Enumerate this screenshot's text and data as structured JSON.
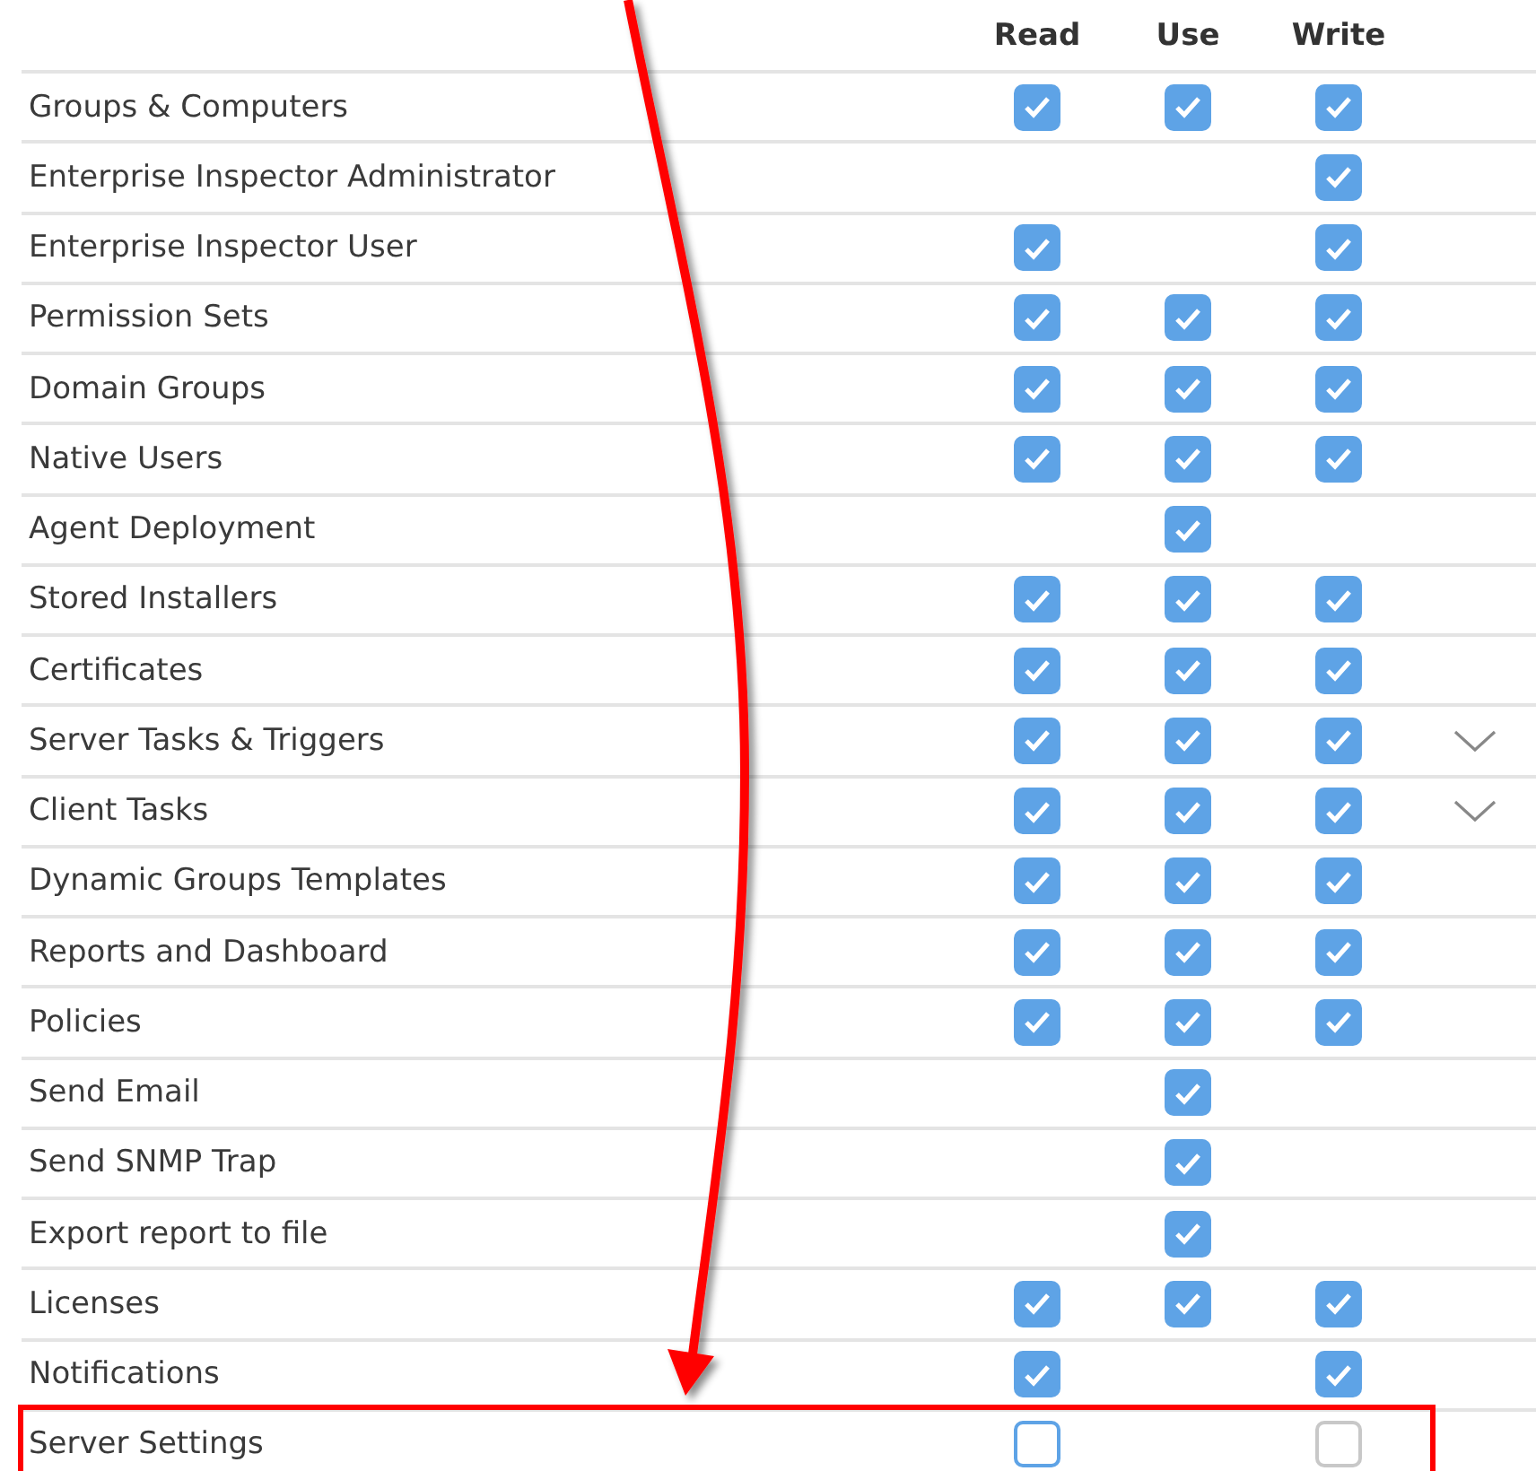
{
  "columns": [
    "Read",
    "Use",
    "Write"
  ],
  "rows": [
    {
      "label": "Groups & Computers",
      "read": {
        "checked": true,
        "disabled": false
      },
      "use": {
        "checked": true,
        "disabled": false
      },
      "write": {
        "checked": true,
        "disabled": false
      },
      "expandable": false,
      "highlighted": false
    },
    {
      "label": "Enterprise Inspector Administrator",
      "write": {
        "checked": true,
        "disabled": false
      },
      "expandable": false,
      "highlighted": false
    },
    {
      "label": "Enterprise Inspector User",
      "read": {
        "checked": true,
        "disabled": false
      },
      "write": {
        "checked": true,
        "disabled": false
      },
      "expandable": false,
      "highlighted": false
    },
    {
      "label": "Permission Sets",
      "read": {
        "checked": true,
        "disabled": false
      },
      "use": {
        "checked": true,
        "disabled": false
      },
      "write": {
        "checked": true,
        "disabled": false
      },
      "expandable": false,
      "highlighted": false
    },
    {
      "label": "Domain Groups",
      "read": {
        "checked": true,
        "disabled": false
      },
      "use": {
        "checked": true,
        "disabled": false
      },
      "write": {
        "checked": true,
        "disabled": false
      },
      "expandable": false,
      "highlighted": false
    },
    {
      "label": "Native Users",
      "read": {
        "checked": true,
        "disabled": false
      },
      "use": {
        "checked": true,
        "disabled": false
      },
      "write": {
        "checked": true,
        "disabled": false
      },
      "expandable": false,
      "highlighted": false
    },
    {
      "label": "Agent Deployment",
      "use": {
        "checked": true,
        "disabled": false
      },
      "expandable": false,
      "highlighted": false
    },
    {
      "label": "Stored Installers",
      "read": {
        "checked": true,
        "disabled": false
      },
      "use": {
        "checked": true,
        "disabled": false
      },
      "write": {
        "checked": true,
        "disabled": false
      },
      "expandable": false,
      "highlighted": false
    },
    {
      "label": "Certificates",
      "read": {
        "checked": true,
        "disabled": false
      },
      "use": {
        "checked": true,
        "disabled": false
      },
      "write": {
        "checked": true,
        "disabled": false
      },
      "expandable": false,
      "highlighted": false
    },
    {
      "label": "Server Tasks & Triggers",
      "read": {
        "checked": true,
        "disabled": false
      },
      "use": {
        "checked": true,
        "disabled": false
      },
      "write": {
        "checked": true,
        "disabled": false
      },
      "expandable": true,
      "highlighted": false
    },
    {
      "label": "Client Tasks",
      "read": {
        "checked": true,
        "disabled": false
      },
      "use": {
        "checked": true,
        "disabled": false
      },
      "write": {
        "checked": true,
        "disabled": false
      },
      "expandable": true,
      "highlighted": false
    },
    {
      "label": "Dynamic Groups Templates",
      "read": {
        "checked": true,
        "disabled": false
      },
      "use": {
        "checked": true,
        "disabled": false
      },
      "write": {
        "checked": true,
        "disabled": false
      },
      "expandable": false,
      "highlighted": false
    },
    {
      "label": "Reports and Dashboard",
      "read": {
        "checked": true,
        "disabled": false
      },
      "use": {
        "checked": true,
        "disabled": false
      },
      "write": {
        "checked": true,
        "disabled": false
      },
      "expandable": false,
      "highlighted": false
    },
    {
      "label": "Policies",
      "read": {
        "checked": true,
        "disabled": false
      },
      "use": {
        "checked": true,
        "disabled": false
      },
      "write": {
        "checked": true,
        "disabled": false
      },
      "expandable": false,
      "highlighted": false
    },
    {
      "label": "Send Email",
      "use": {
        "checked": true,
        "disabled": false
      },
      "expandable": false,
      "highlighted": false
    },
    {
      "label": "Send SNMP Trap",
      "use": {
        "checked": true,
        "disabled": false
      },
      "expandable": false,
      "highlighted": false
    },
    {
      "label": "Export report to file",
      "use": {
        "checked": true,
        "disabled": false
      },
      "expandable": false,
      "highlighted": false
    },
    {
      "label": "Licenses",
      "read": {
        "checked": true,
        "disabled": false
      },
      "use": {
        "checked": true,
        "disabled": false
      },
      "write": {
        "checked": true,
        "disabled": false
      },
      "expandable": false,
      "highlighted": false
    },
    {
      "label": "Notifications",
      "read": {
        "checked": true,
        "disabled": false
      },
      "write": {
        "checked": true,
        "disabled": false
      },
      "expandable": false,
      "highlighted": false
    },
    {
      "label": "Server Settings",
      "read": {
        "checked": false,
        "disabled": false
      },
      "write": {
        "checked": false,
        "disabled": true
      },
      "expandable": false,
      "highlighted": true
    }
  ]
}
